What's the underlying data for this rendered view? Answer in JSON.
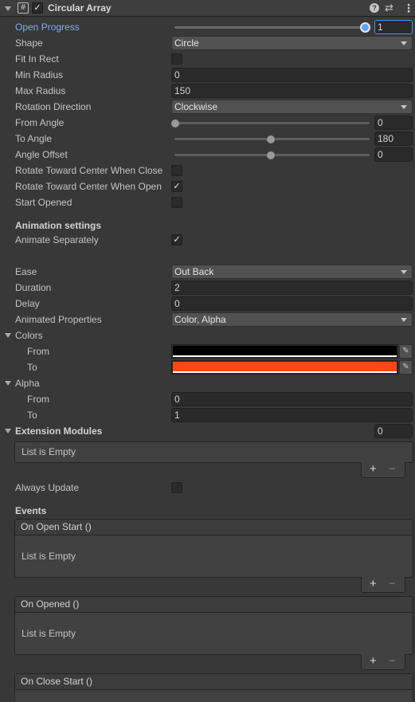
{
  "component": {
    "title": "Circular Array",
    "enabled": true
  },
  "open_progress": {
    "label": "Open Progress",
    "value": "1",
    "fraction": 1.0
  },
  "shape": {
    "label": "Shape",
    "value": "Circle"
  },
  "fit_in_rect": {
    "label": "Fit In Rect",
    "checked": false
  },
  "min_radius": {
    "label": "Min Radius",
    "value": "0"
  },
  "max_radius": {
    "label": "Max Radius",
    "value": "150"
  },
  "rotation_direction": {
    "label": "Rotation Direction",
    "value": "Clockwise"
  },
  "from_angle": {
    "label": "From Angle",
    "value": "0",
    "fraction": 0.0
  },
  "to_angle": {
    "label": "To Angle",
    "value": "180",
    "fraction": 0.5
  },
  "angle_offset": {
    "label": "Angle Offset",
    "value": "0",
    "fraction": 0.5
  },
  "rotate_close": {
    "label": "Rotate Toward Center When Close",
    "checked": false
  },
  "rotate_open": {
    "label": "Rotate Toward Center When Open",
    "checked": true
  },
  "start_opened": {
    "label": "Start Opened",
    "checked": false
  },
  "animation": {
    "heading": "Animation settings",
    "animate_separately": {
      "label": "Animate Separately",
      "checked": true
    },
    "ease": {
      "label": "Ease",
      "value": "Out Back"
    },
    "duration": {
      "label": "Duration",
      "value": "2"
    },
    "delay": {
      "label": "Delay",
      "value": "0"
    },
    "animated_properties": {
      "label": "Animated Properties",
      "value": "Color, Alpha"
    }
  },
  "colors": {
    "label": "Colors",
    "from": {
      "label": "From",
      "color": "#000000"
    },
    "to": {
      "label": "To",
      "color": "#ff4a0e"
    }
  },
  "alpha": {
    "label": "Alpha",
    "from": {
      "label": "From",
      "value": "0"
    },
    "to": {
      "label": "To",
      "value": "1"
    }
  },
  "extension_modules": {
    "label": "Extension Modules",
    "count": "0",
    "empty_text": "List is Empty"
  },
  "always_update": {
    "label": "Always Update",
    "checked": false
  },
  "events": {
    "heading": "Events",
    "items": [
      {
        "title": "On Open Start ()",
        "empty_text": "List is Empty"
      },
      {
        "title": "On Opened ()",
        "empty_text": "List is Empty"
      },
      {
        "title": "On Close Start ()"
      }
    ]
  },
  "glyphs": {
    "plus": "+",
    "minus": "−",
    "check": "✓",
    "picker": "✎",
    "help": "?",
    "preset": "⇄",
    "menu": "⋮",
    "script": "#"
  }
}
